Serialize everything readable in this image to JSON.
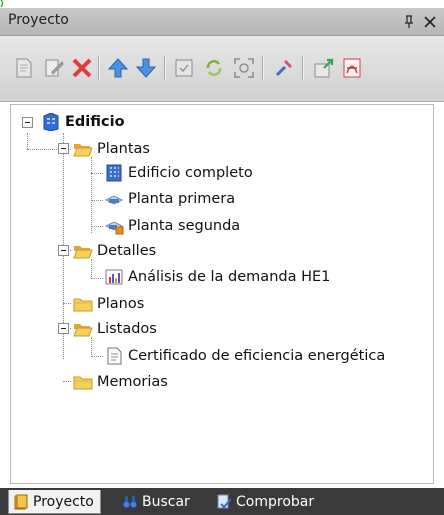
{
  "panel": {
    "title": "Proyecto"
  },
  "header": {
    "pin_icon": "pin-icon",
    "close_icon": "close-icon"
  },
  "toolbar": {
    "tools": [
      "new-page-icon",
      "edit-page-icon",
      "delete-icon",
      "move-up-icon",
      "move-down-icon",
      "properties-icon",
      "refresh-icon",
      "fit-view-icon",
      "tool-icon",
      "export-icon",
      "pdf-icon"
    ]
  },
  "tree": {
    "root": "Edificio",
    "plantas": {
      "label": "Plantas",
      "children": [
        "Edificio completo",
        "Planta primera",
        "Planta segunda"
      ]
    },
    "detalles": {
      "label": "Detalles",
      "children": [
        "Análisis de la demanda HE1"
      ]
    },
    "planos": {
      "label": "Planos"
    },
    "listados": {
      "label": "Listados",
      "children": [
        "Certificado de eficiencia energética"
      ]
    },
    "memorias": {
      "label": "Memorias"
    }
  },
  "tabs": [
    {
      "label": "Proyecto",
      "active": true
    },
    {
      "label": "Buscar",
      "active": false
    },
    {
      "label": "Comprobar",
      "active": false
    }
  ],
  "colors": {
    "header_bg": "#c0c0c0",
    "tab_bar_bg": "#3a3a3a",
    "folder": "#f2c544",
    "accent_blue": "#2e6fd6"
  }
}
